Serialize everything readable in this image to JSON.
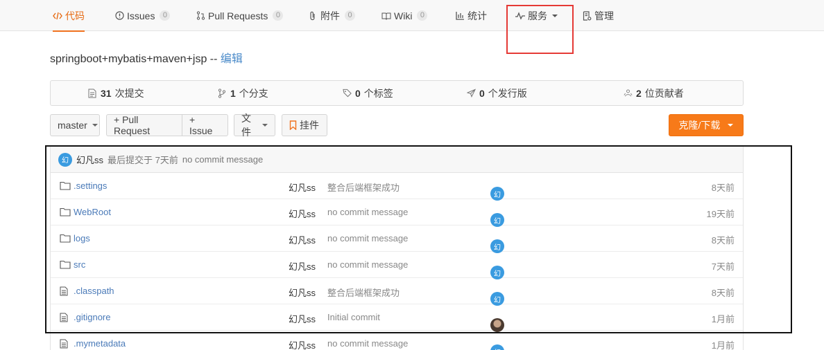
{
  "tabs": [
    {
      "label": "代码",
      "icon": "code-icon",
      "active": true
    },
    {
      "label": "Issues",
      "icon": "issue-icon",
      "count": "0"
    },
    {
      "label": "Pull Requests",
      "icon": "pull-request-icon",
      "count": "0"
    },
    {
      "label": "附件",
      "icon": "paperclip-icon",
      "count": "0"
    },
    {
      "label": "Wiki",
      "icon": "book-icon",
      "count": "0"
    },
    {
      "label": "统计",
      "icon": "bar-chart-icon"
    },
    {
      "label": "服务",
      "icon": "pulse-icon",
      "dropdown": true
    },
    {
      "label": "管理",
      "icon": "settings-doc-icon"
    }
  ],
  "project": {
    "name": "springboot+mybatis+maven+jsp -- ",
    "edit_label": "编辑"
  },
  "stats": {
    "commits_num": "31",
    "commits_label": "次提交",
    "branches_num": "1",
    "branches_label": "个分支",
    "tags_num": "0",
    "tags_label": "个标签",
    "releases_num": "0",
    "releases_label": "个发行版",
    "contributors_num": "2",
    "contributors_label": "位贡献者"
  },
  "toolbar": {
    "branch": "master",
    "pull_request": "+ Pull Request",
    "issue": "+ Issue",
    "file": "文件",
    "widget": "挂件",
    "clone": "克隆/下载"
  },
  "last_commit": {
    "author": "幻凡ss",
    "meta": "最后提交于 7天前",
    "message": "no commit message"
  },
  "files": [
    {
      "name": ".settings",
      "type": "folder",
      "author": "幻凡ss",
      "message": "整合后端框架成功",
      "age": "8天前",
      "avatar": "幻"
    },
    {
      "name": "WebRoot",
      "type": "folder",
      "author": "幻凡ss",
      "message": "no commit message",
      "age": "19天前",
      "avatar": "幻"
    },
    {
      "name": "logs",
      "type": "folder",
      "author": "幻凡ss",
      "message": "no commit message",
      "age": "8天前",
      "avatar": "幻"
    },
    {
      "name": "src",
      "type": "folder",
      "author": "幻凡ss",
      "message": "no commit message",
      "age": "7天前",
      "avatar": "幻"
    },
    {
      "name": ".classpath",
      "type": "file",
      "author": "幻凡ss",
      "message": "整合后端框架成功",
      "age": "8天前",
      "avatar": "幻"
    },
    {
      "name": ".gitignore",
      "type": "file",
      "author": "幻凡ss",
      "message": "Initial commit",
      "age": "1月前",
      "avatar": "photo"
    },
    {
      "name": ".mymetadata",
      "type": "file",
      "author": "幻凡ss",
      "message": "no commit message",
      "age": "1月前",
      "avatar": "幻"
    }
  ],
  "colors": {
    "accent": "#f0721f",
    "link": "#4a7ab8",
    "highlight_red": "#e53935",
    "highlight_black": "#111111"
  }
}
